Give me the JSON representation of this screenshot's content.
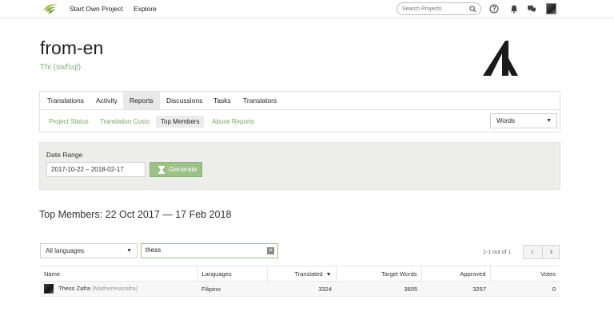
{
  "nav": {
    "links": [
      "Start Own Project",
      "Explore"
    ],
    "search_placeholder": "Search Projects"
  },
  "project": {
    "title": "from-en",
    "owner": "Thi (swfsql)"
  },
  "tabs": [
    {
      "label": "Translations",
      "active": false
    },
    {
      "label": "Activity",
      "active": false
    },
    {
      "label": "Reports",
      "active": true
    },
    {
      "label": "Discussions",
      "active": false
    },
    {
      "label": "Tasks",
      "active": false
    },
    {
      "label": "Translators",
      "active": false
    }
  ],
  "subtabs": [
    {
      "label": "Project Status",
      "active": false
    },
    {
      "label": "Translation Costs",
      "active": false
    },
    {
      "label": "Top Members",
      "active": true
    },
    {
      "label": "Abuse Reports",
      "active": false
    }
  ],
  "unit_select": "Words",
  "date_range": {
    "label": "Date Range",
    "value": "2017-10-22 – 2018-02-17",
    "button": "Generate"
  },
  "section_title": "Top Members: 22 Oct 2017 — 17 Feb 2018",
  "filters": {
    "language": "All languages",
    "search_value": "thess"
  },
  "pager": {
    "text": "1-1 out of 1"
  },
  "table": {
    "headers": [
      "Name",
      "Languages",
      "Translated",
      "Target Words",
      "Approved",
      "Votes"
    ],
    "rows": [
      {
        "name": "Thess Zafra",
        "handle": "(Matheresazafra)",
        "language": "Filipino",
        "translated": "3324",
        "target_words": "3605",
        "approved": "3257",
        "votes": "0"
      }
    ]
  },
  "colors": {
    "accent_green": "#79a463",
    "button_green": "#9cc285",
    "panel_grey": "#ededeb"
  }
}
